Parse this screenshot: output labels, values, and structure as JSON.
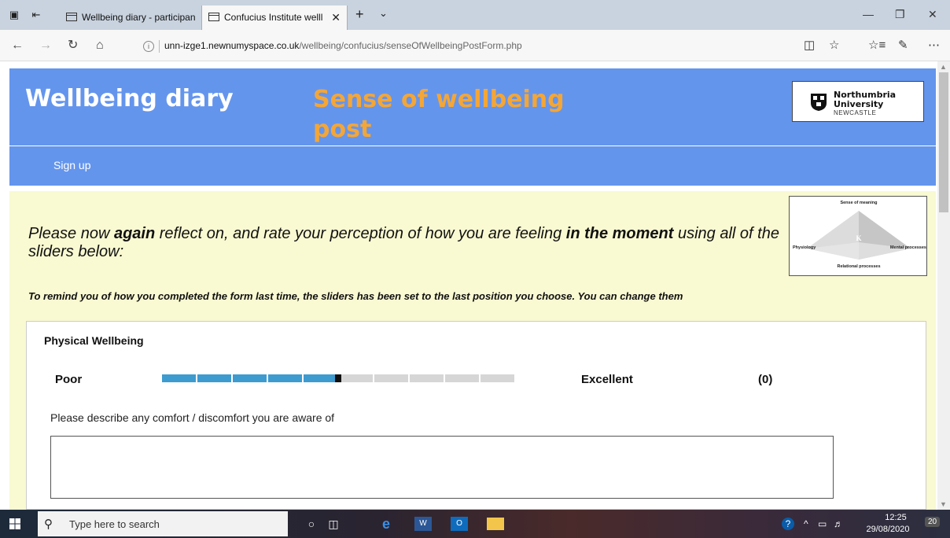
{
  "browser": {
    "tabs": [
      {
        "title": "Wellbeing diary - participan"
      },
      {
        "title": "Confucius Institute welll"
      }
    ],
    "url_host": "unn-izge1.newnumyspace.co.uk",
    "url_path": "/wellbeing/confucius/senseOfWellbeingPostForm.php"
  },
  "header": {
    "site_title": "Wellbeing diary",
    "page_heading": "Sense of wellbeing post",
    "logo": {
      "line1": "Northumbria",
      "line2": "University",
      "line3": "NEWCASTLE"
    }
  },
  "nav": {
    "signup": "Sign up"
  },
  "intro": {
    "part1": "Please now ",
    "again": "again",
    "part2": " reflect on, and rate your perception of how you are feeling ",
    "moment": "in the moment",
    "part3": " using all of the sliders below:"
  },
  "diagram": {
    "top": "Sense of meaning",
    "left": "Physiology",
    "right": "Mental processes",
    "bottom": "Relational processes",
    "center": "K"
  },
  "reminder": "To remind you of how you completed the form last time, the sliders has been set to the last position you choose. You can change them",
  "physical": {
    "title": "Physical Wellbeing",
    "low_label": "Poor",
    "high_label": "Excellent",
    "value_display": "(0)",
    "slider_fraction": 0.5,
    "prompt": "Please describe any comfort / discomfort you are aware of",
    "comment_value": ""
  },
  "colors": {
    "header_blue": "#6495ed",
    "heading_orange": "#f4a636",
    "panel_yellow": "#f9f9d2",
    "slider_fill": "#3d9bd0",
    "slider_empty": "#d6d6d6"
  },
  "taskbar": {
    "search_placeholder": "Type here to search",
    "time": "12:25",
    "date": "29/08/2020",
    "notifications": "20"
  }
}
